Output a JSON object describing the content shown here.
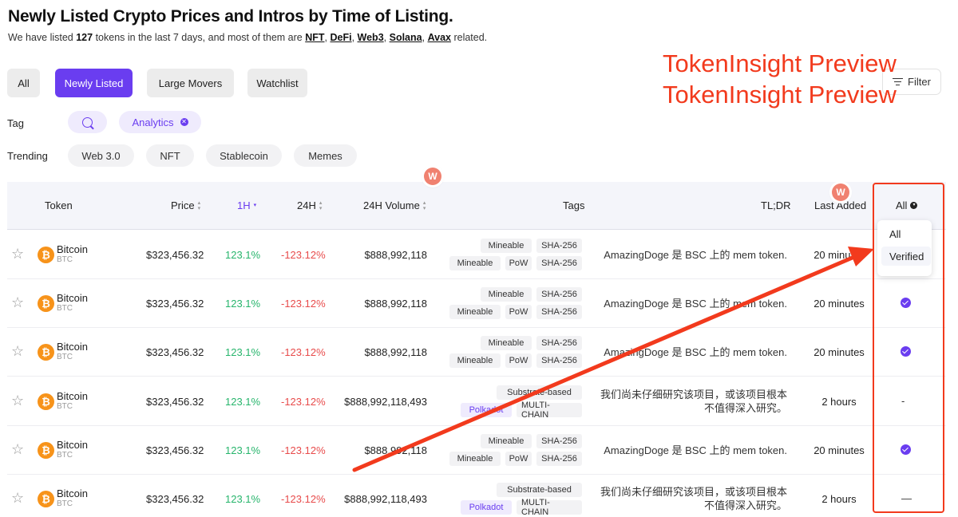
{
  "header": {
    "title": "Newly Listed Crypto Prices and Intros by Time of Listing.",
    "subtitle_prefix": "We have listed ",
    "subtitle_count": "127",
    "subtitle_mid": " tokens in the last 7 days, and most of them are ",
    "subtitle_links": [
      "NFT",
      "DeFi",
      "Web3",
      "Solana",
      "Avax"
    ],
    "subtitle_sep": ", ",
    "subtitle_suffix": " related."
  },
  "tabs": [
    {
      "label": "All",
      "active": false
    },
    {
      "label": "Newly Listed",
      "active": true
    },
    {
      "label": "Large Movers",
      "active": false
    },
    {
      "label": "Watchlist",
      "active": false
    }
  ],
  "filter": {
    "label": "Filter",
    "icon": "filter-icon"
  },
  "watermark": {
    "lines": [
      "TokenInsight Preview",
      "TokenInsight Preview"
    ],
    "color": "#f23a1d"
  },
  "tag_row": {
    "label": "Tag",
    "search_icon": "search-icon",
    "active_tag": "Analytics"
  },
  "trending_row": {
    "label": "Trending",
    "items": [
      "Web 3.0",
      "NFT",
      "Stablecoin",
      "Memes"
    ]
  },
  "table": {
    "columns": {
      "token": "Token",
      "price": "Price",
      "h1": "1H",
      "h24": "24H",
      "volume": "24H Volume",
      "tags": "Tags",
      "tldr": "TL;DR",
      "last_added": "Last Added",
      "all": "All"
    },
    "rows": [
      {
        "name": "Bitcoin",
        "symbol": "BTC",
        "price": "$323,456.32",
        "h1": "123.1%",
        "h24": "-123.12%",
        "volume": "$888,992,118",
        "tags": [
          [
            "Mineable",
            "SHA-256"
          ],
          [
            "Mineable",
            "PoW",
            "SHA-256"
          ]
        ],
        "tldr": [
          "AmazingDoge 是 BSC 上的 mem token."
        ],
        "last_added": "20 minutes",
        "status": "none"
      },
      {
        "name": "Bitcoin",
        "symbol": "BTC",
        "price": "$323,456.32",
        "h1": "123.1%",
        "h24": "-123.12%",
        "volume": "$888,992,118",
        "tags": [
          [
            "Mineable",
            "SHA-256"
          ],
          [
            "Mineable",
            "PoW",
            "SHA-256"
          ]
        ],
        "tldr": [
          "AmazingDoge 是 BSC 上的 mem token."
        ],
        "last_added": "20 minutes",
        "status": "verified"
      },
      {
        "name": "Bitcoin",
        "symbol": "BTC",
        "price": "$323,456.32",
        "h1": "123.1%",
        "h24": "-123.12%",
        "volume": "$888,992,118",
        "tags": [
          [
            "Mineable",
            "SHA-256"
          ],
          [
            "Mineable",
            "PoW",
            "SHA-256"
          ]
        ],
        "tldr": [
          "AmazingDoge 是 BSC 上的 mem token."
        ],
        "last_added": "20 minutes",
        "status": "verified"
      },
      {
        "name": "Bitcoin",
        "symbol": "BTC",
        "price": "$323,456.32",
        "h1": "123.1%",
        "h24": "-123.12%",
        "volume": "$888,992,118,493",
        "tags": [
          [
            "Substrate-based"
          ],
          [
            "Polkadot",
            "MULTI-CHAIN"
          ]
        ],
        "tldr": [
          "我们尚未仔细研究该项目，或该项目根本",
          "不值得深入研究。"
        ],
        "last_added": "2 hours",
        "status": "-"
      },
      {
        "name": "Bitcoin",
        "symbol": "BTC",
        "price": "$323,456.32",
        "h1": "123.1%",
        "h24": "-123.12%",
        "volume": "$888,992,118",
        "tags": [
          [
            "Mineable",
            "SHA-256"
          ],
          [
            "Mineable",
            "PoW",
            "SHA-256"
          ]
        ],
        "tldr": [
          "AmazingDoge 是 BSC 上的 mem token."
        ],
        "last_added": "20 minutes",
        "status": "verified"
      },
      {
        "name": "Bitcoin",
        "symbol": "BTC",
        "price": "$323,456.32",
        "h1": "123.1%",
        "h24": "-123.12%",
        "volume": "$888,992,118,493",
        "tags": [
          [
            "Substrate-based"
          ],
          [
            "Polkadot",
            "MULTI-CHAIN"
          ]
        ],
        "tldr": [
          "我们尚未仔细研究该项目，或该项目根本",
          "不值得深入研究。"
        ],
        "last_added": "2 hours",
        "status": "—"
      }
    ]
  },
  "dropdown": {
    "items": [
      "All",
      "Verified"
    ],
    "selected": "Verified"
  },
  "avatars": [
    "W",
    "W"
  ],
  "colors": {
    "accent": "#6a3df0",
    "up": "#27b56c",
    "down": "#e84b4b",
    "annotation": "#f23a1d",
    "coin": "#f7931a"
  }
}
